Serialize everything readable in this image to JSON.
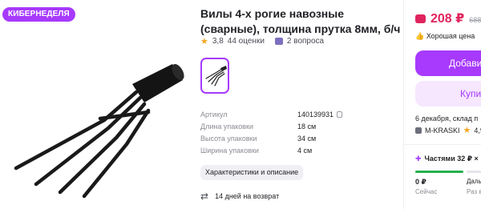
{
  "badge": "КИБЕРНЕДЕЛЯ",
  "product": {
    "title": "Вилы 4-х рогие навозные (сварные), толщина прутка 8мм, б/ч",
    "rating": "3,8",
    "reviews": "44 оценки",
    "questions": "2 вопроса"
  },
  "specs": [
    {
      "label": "Артикул",
      "value": "140139931"
    },
    {
      "label": "Длина упаковки",
      "value": "18 см"
    },
    {
      "label": "Высота упаковки",
      "value": "34 см"
    },
    {
      "label": "Ширина упаковки",
      "value": "4 см"
    }
  ],
  "characteristics_button": "Характеристики и описание",
  "return_policy": "14 дней на возврат",
  "panel": {
    "price": "208 ₽",
    "old_price": "688",
    "good_price": "Хорошая цена",
    "add_button": "Добави",
    "buy_button": "Купи",
    "delivery": "6 декабря, склад п",
    "seller": "M-KRASKI",
    "seller_rating": "4,9",
    "installment": "Частями 32 ₽ ×",
    "inst_amount": "0 ₽",
    "inst_now": "Сейчас",
    "inst_next": "Даль",
    "inst_next2": "Раз в 2"
  },
  "colors": {
    "accent": "#a73afd",
    "price": "#e0245e",
    "progress": "#22b14c"
  }
}
